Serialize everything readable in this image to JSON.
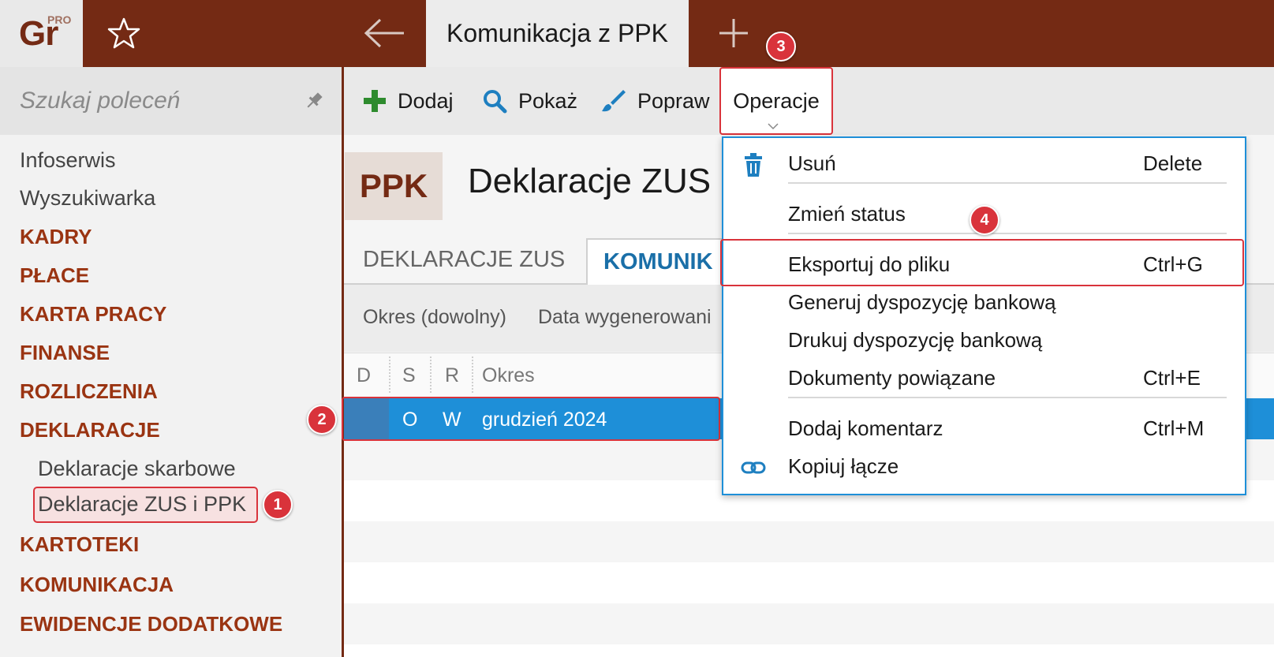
{
  "app": {
    "logo_text": "Gr",
    "logo_badge": "PRO"
  },
  "titlebar": {
    "active_tab": "Komunikacja z PPK"
  },
  "sidebar": {
    "search_placeholder": "Szukaj poleceń",
    "items": [
      {
        "label": "Infoserwis",
        "kind": "plain"
      },
      {
        "label": "Wyszukiwarka",
        "kind": "plain"
      },
      {
        "label": "KADRY",
        "kind": "section"
      },
      {
        "label": "PŁACE",
        "kind": "section"
      },
      {
        "label": "KARTA PRACY",
        "kind": "section"
      },
      {
        "label": "FINANSE",
        "kind": "section"
      },
      {
        "label": "ROZLICZENIA",
        "kind": "section"
      },
      {
        "label": "DEKLARACJE",
        "kind": "section"
      },
      {
        "label": "Deklaracje skarbowe",
        "kind": "sub"
      },
      {
        "label": "Deklaracje ZUS i PPK",
        "kind": "sub",
        "selected": true
      },
      {
        "label": "KARTOTEKI",
        "kind": "section"
      },
      {
        "label": "KOMUNIKACJA",
        "kind": "section"
      },
      {
        "label": "EWIDENCJE DODATKOWE",
        "kind": "section"
      }
    ]
  },
  "toolbar": {
    "add_label": "Dodaj",
    "show_label": "Pokaż",
    "edit_label": "Popraw",
    "operations_label": "Operacje"
  },
  "page": {
    "badge": "PPK",
    "title": "Deklaracje ZUS i",
    "tabs": [
      "DEKLARACJE ZUS",
      "KOMUNIK"
    ],
    "filters": [
      "Okres (dowolny)",
      "Data wygenerowani"
    ]
  },
  "grid": {
    "columns": [
      "D",
      "S",
      "R",
      "Okres"
    ],
    "rows": [
      {
        "d": "",
        "s": "O",
        "r": "W",
        "okres": "grudzień 2024",
        "selected": true
      }
    ]
  },
  "menu": {
    "items": [
      {
        "label": "Usuń",
        "shortcut": "Delete",
        "icon": "trash-icon"
      },
      {
        "label": "Zmień status",
        "shortcut": ""
      },
      {
        "label": "Eksportuj do pliku",
        "shortcut": "Ctrl+G",
        "highlighted": true
      },
      {
        "label": "Generuj dyspozycję bankową",
        "shortcut": ""
      },
      {
        "label": "Drukuj dyspozycję bankową",
        "shortcut": ""
      },
      {
        "label": "Dokumenty powiązane",
        "shortcut": "Ctrl+E"
      },
      {
        "label": "Dodaj komentarz",
        "shortcut": "Ctrl+M"
      },
      {
        "label": "Kopiuj łącze",
        "shortcut": "",
        "icon": "link-icon"
      }
    ]
  },
  "markers": [
    "1",
    "2",
    "3",
    "4"
  ],
  "colors": {
    "brand": "#742a14",
    "section": "#9a3412",
    "selection": "#1e8fd8",
    "annotation": "#d9333b",
    "add_icon": "#2e8b2e",
    "search_icon": "#1e7fc0",
    "link": "#1a6fa8"
  }
}
